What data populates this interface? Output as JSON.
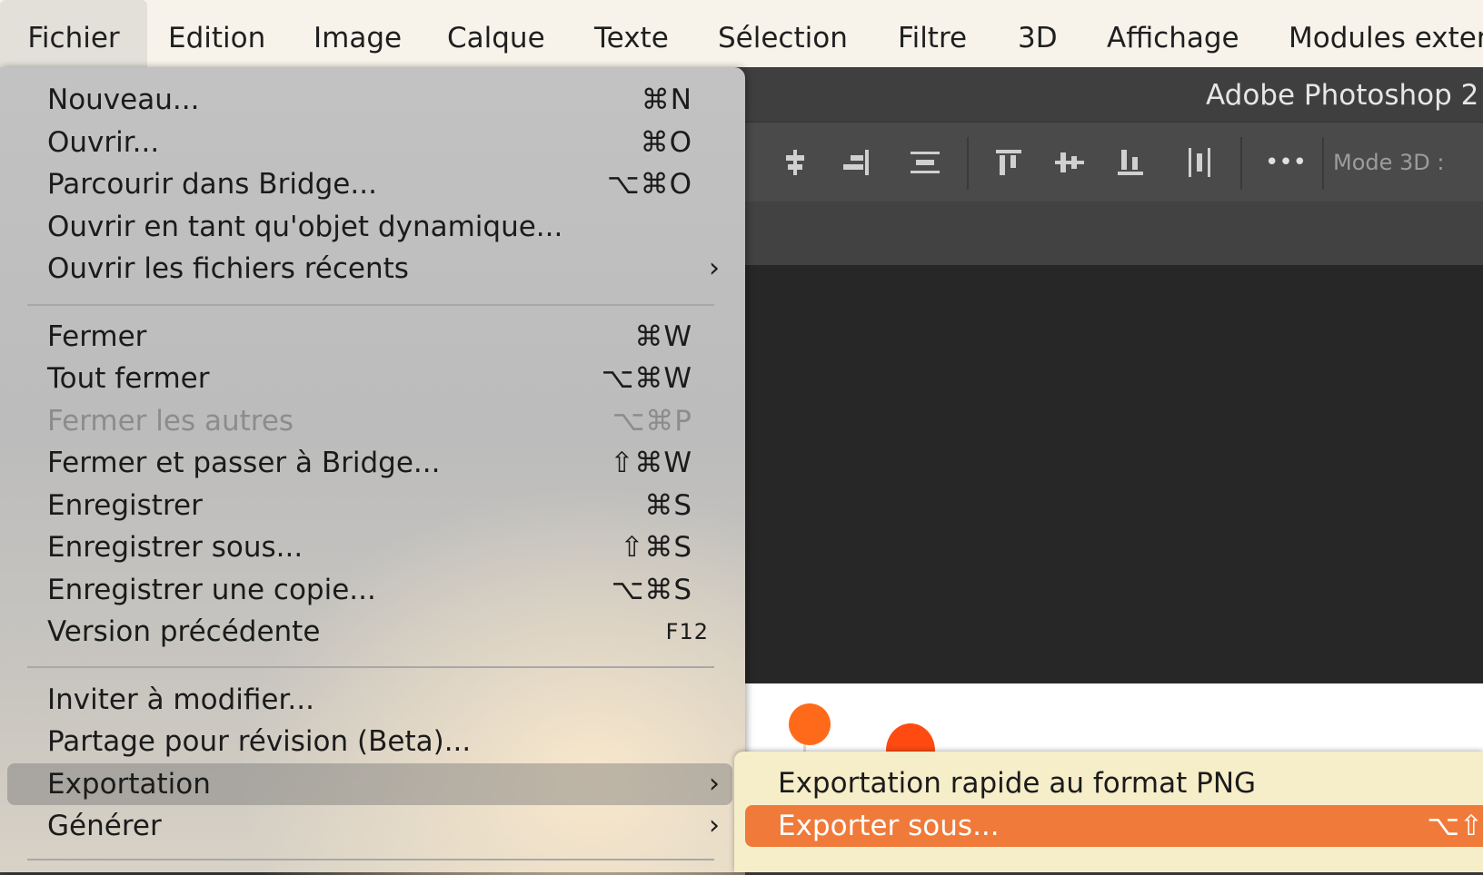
{
  "menubar": {
    "items": [
      "Fichier",
      "Edition",
      "Image",
      "Calque",
      "Texte",
      "Sélection",
      "Filtre",
      "3D",
      "Affichage",
      "Modules exter"
    ]
  },
  "titlebar": {
    "title": "Adobe Photoshop 2"
  },
  "optionsbar": {
    "mode3d": "Mode 3D :",
    "more": "•••"
  },
  "file_menu": {
    "open_section": [
      {
        "label": "Nouveau...",
        "shortcut": "⌘N"
      },
      {
        "label": "Ouvrir...",
        "shortcut": "⌘O"
      },
      {
        "label": "Parcourir dans Bridge...",
        "shortcut": "⌥⌘O"
      },
      {
        "label": "Ouvrir en tant qu'objet dynamique...",
        "shortcut": ""
      },
      {
        "label": "Ouvrir les fichiers récents",
        "shortcut": "›"
      }
    ],
    "save_section": [
      {
        "label": "Fermer",
        "shortcut": "⌘W"
      },
      {
        "label": "Tout fermer",
        "shortcut": "⌥⌘W"
      },
      {
        "label": "Fermer les autres",
        "shortcut": "⌥⌘P"
      },
      {
        "label": "Fermer et passer à Bridge...",
        "shortcut": "⇧⌘W"
      },
      {
        "label": "Enregistrer",
        "shortcut": "⌘S"
      },
      {
        "label": "Enregistrer sous...",
        "shortcut": "⇧⌘S"
      },
      {
        "label": "Enregistrer une copie...",
        "shortcut": "⌥⌘S"
      },
      {
        "label": "Version précédente",
        "shortcut": "F12"
      }
    ],
    "share_section": [
      {
        "label": "Inviter à modifier...",
        "shortcut": ""
      },
      {
        "label": "Partage pour révision (Beta)...",
        "shortcut": ""
      },
      {
        "label": "Exportation",
        "shortcut": "›"
      },
      {
        "label": "Générer",
        "shortcut": "›"
      }
    ]
  },
  "export_submenu": [
    {
      "label": "Exportation rapide au format PNG",
      "shortcut": ""
    },
    {
      "label": "Exporter sous...",
      "shortcut": "⌥⇧"
    }
  ],
  "colors": {
    "highlight": "#f07a3a",
    "menubar": "#f7f3ea",
    "app_dark": "#2b2b2b"
  }
}
